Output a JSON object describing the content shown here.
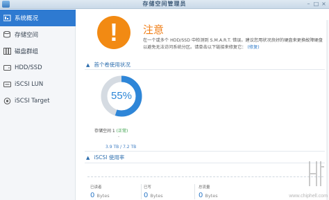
{
  "window": {
    "title": "存储空间管理员"
  },
  "sidebar": {
    "items": [
      {
        "label": "系统概况",
        "icon": "overview-icon",
        "active": true
      },
      {
        "label": "存储空间",
        "icon": "storage-volume-icon",
        "active": false
      },
      {
        "label": "磁盘群组",
        "icon": "disk-group-icon",
        "active": false
      },
      {
        "label": "HDD/SSD",
        "icon": "hdd-icon",
        "active": false
      },
      {
        "label": "iSCSI LUN",
        "icon": "iscsi-lun-icon",
        "active": false
      },
      {
        "label": "iSCSI Target",
        "icon": "iscsi-target-icon",
        "active": false
      }
    ]
  },
  "alert": {
    "title": "注意",
    "message": "在一个或多个 HDD/SSD 中检测到 S.M.A.R.T. 错误。建议您用状况良好的硬盘来更换故障硬盘以避免无法访问系统分区。请单击以下链接来修复它：",
    "link": "(修复)",
    "color": "#f28a13"
  },
  "volume_usage": {
    "section_title": "首个卷使用状况",
    "percent": 55,
    "percent_label": "55%",
    "volume_name": "存储空间 1",
    "status": "(正常)",
    "dash": "-",
    "size": "3.9 TB / 7.2 TB",
    "used_color": "#2e86d8",
    "free_color": "#d5dbe2"
  },
  "iscsi": {
    "section_title": "iSCSI 使用率",
    "stats": [
      {
        "label": "已读者",
        "value": "0",
        "unit": "Bytes"
      },
      {
        "label": "已写",
        "value": "0",
        "unit": "Bytes"
      },
      {
        "label": "总流量",
        "value": "0",
        "unit": "Bytes"
      }
    ]
  },
  "watermark": {
    "text": "www.chiphell.com"
  }
}
